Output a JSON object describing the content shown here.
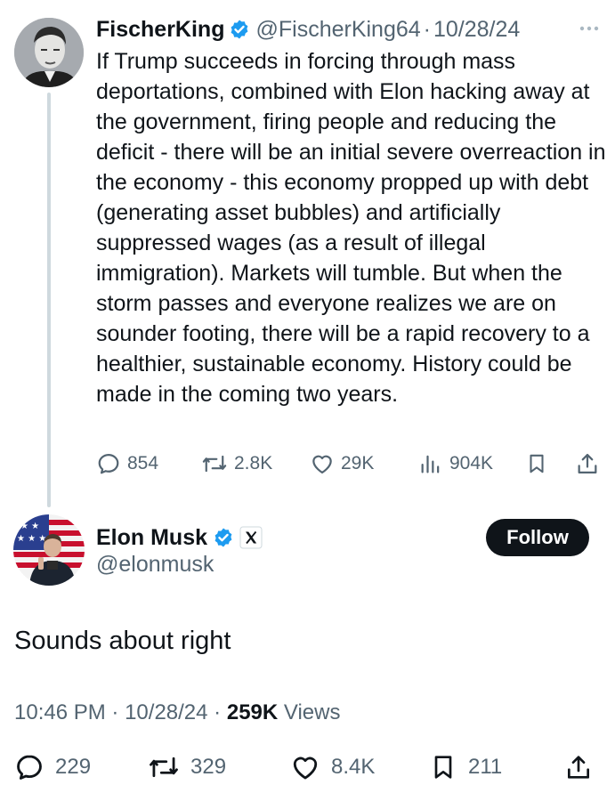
{
  "parent_tweet": {
    "author_name": "FischerKing",
    "handle": "@FischerKing64",
    "separator": "·",
    "date": "10/28/24",
    "text": "If Trump succeeds in forcing through mass deportations, combined with Elon hacking away at the government, firing people and reducing the deficit - there will be an initial severe overreaction in the economy - this economy propped up with debt (generating asset bubbles) and artificially suppressed wages (as a result of illegal immigration). Markets will tumble. But when the storm passes and everyone realizes we are on sounder footing, there will be a rapid recovery to a healthier, sustainable economy. History could be made in the coming two years.",
    "replies": "854",
    "reposts": "2.8K",
    "likes": "29K",
    "views": "904K"
  },
  "reply_tweet": {
    "author_name": "Elon Musk",
    "handle": "@elonmusk",
    "follow_label": "Follow",
    "text": "Sounds about right",
    "time": "10:46 PM",
    "separator": "·",
    "date": "10/28/24",
    "views_count": "259K",
    "views_label": "Views",
    "replies": "229",
    "reposts": "329",
    "likes": "8.4K",
    "bookmarks": "211"
  },
  "colors": {
    "text_primary": "#0f1419",
    "text_secondary": "#536471",
    "verified_blue": "#1d9bf0",
    "thread_line": "#cfd9de",
    "button_dark": "#0f1419"
  },
  "icons": [
    "verified-badge-icon",
    "more-icon",
    "reply-icon",
    "repost-icon",
    "like-icon",
    "views-icon",
    "bookmark-icon",
    "share-icon",
    "x-logo-icon"
  ]
}
